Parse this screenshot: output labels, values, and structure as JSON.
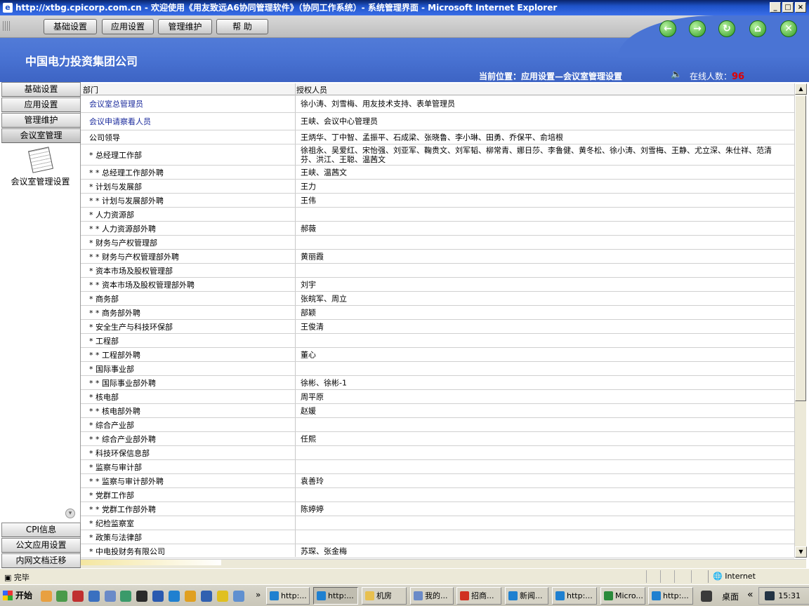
{
  "window": {
    "title": "http://xtbg.cpicorp.com.cn - 欢迎使用《用友致远A6协同管理软件》（协同工作系统）- 系统管理界面 - Microsoft Internet Explorer",
    "min": "_",
    "max": "□",
    "close": "×"
  },
  "topnav": {
    "items": [
      "基础设置",
      "应用设置",
      "管理维护",
      "帮  助"
    ]
  },
  "header": {
    "company": "中国电力投资集团公司",
    "location_label": "当前位置：",
    "location_value": "应用设置—会议室管理设置",
    "online_label": "在线人数：",
    "online_count": "96"
  },
  "sidebar": {
    "tabs": [
      "基础设置",
      "应用设置",
      "管理维护",
      "会议室管理"
    ],
    "item_label": "会议室管理设置",
    "bottom_tabs": [
      "CPI信息",
      "公文应用设置",
      "内网文档迁移"
    ]
  },
  "table": {
    "col_dept": "部门",
    "col_people": "授权人员",
    "rows": [
      {
        "dept": "会议室总管理员",
        "people": "徐小涛、刘雪梅、用友技术支持、表单管理员",
        "link": true
      },
      {
        "dept": "会议申请察看人员",
        "people": "王峡、会议中心管理员",
        "link": true
      },
      {
        "dept": "公司领导",
        "people": "王炳华、丁中智、孟振平、石成梁、张晓鲁、李小琳、田勇、乔保平、俞培根"
      },
      {
        "dept": "* 总经理工作部",
        "people": "徐祖永、吴爱红、宋怡强、刘亚军、鞠贵文、刘军韬、柳常青、娜日莎、李鲁健、黄冬松、徐小涛、刘雪梅、王静、尤立深、朱仕祥、范清芬、洪江、王聪、温茜文",
        "tall": true
      },
      {
        "dept": "* * 总经理工作部外聘",
        "people": "王峡、温茜文"
      },
      {
        "dept": "* 计划与发展部",
        "people": "王力"
      },
      {
        "dept": "* * 计划与发展部外聘",
        "people": "王伟"
      },
      {
        "dept": "* 人力资源部",
        "people": ""
      },
      {
        "dept": "* * 人力资源部外聘",
        "people": "郝薇"
      },
      {
        "dept": "* 财务与产权管理部",
        "people": ""
      },
      {
        "dept": "* * 财务与产权管理部外聘",
        "people": "黄丽霞"
      },
      {
        "dept": "* 资本市场及股权管理部",
        "people": ""
      },
      {
        "dept": "* * 资本市场及股权管理部外聘",
        "people": "刘宇"
      },
      {
        "dept": "* 商务部",
        "people": "张皖军、周立"
      },
      {
        "dept": "* * 商务部外聘",
        "people": "部颖"
      },
      {
        "dept": "* 安全生产与科技环保部",
        "people": "王俊清"
      },
      {
        "dept": "* 工程部",
        "people": ""
      },
      {
        "dept": "* * 工程部外聘",
        "people": "董心"
      },
      {
        "dept": "* 国际事业部",
        "people": ""
      },
      {
        "dept": "* * 国际事业部外聘",
        "people": "徐彬、徐彬-1"
      },
      {
        "dept": "* 核电部",
        "people": "周平原"
      },
      {
        "dept": "* * 核电部外聘",
        "people": "赵媛"
      },
      {
        "dept": "* 综合产业部",
        "people": ""
      },
      {
        "dept": "* * 综合产业部外聘",
        "people": "任熙"
      },
      {
        "dept": "* 科技环保信息部",
        "people": ""
      },
      {
        "dept": "* 监察与审计部",
        "people": ""
      },
      {
        "dept": "* * 监察与审计部外聘",
        "people": "袁善玲"
      },
      {
        "dept": "* 党群工作部",
        "people": ""
      },
      {
        "dept": "* * 党群工作部外聘",
        "people": "陈婷婷"
      },
      {
        "dept": "* 纪检监察室",
        "people": ""
      },
      {
        "dept": "* 政策与法律部",
        "people": ""
      },
      {
        "dept": "* 中电投财务有限公司",
        "people": "苏琛、张金梅"
      }
    ]
  },
  "statusbar": {
    "status": "完毕",
    "zone": "Internet"
  },
  "taskbar": {
    "start": "开始",
    "buttons": [
      "http:...",
      "http:...",
      "机房",
      "我的...",
      "招商...",
      "新闻...",
      "http:...",
      "Micro...",
      "http:..."
    ],
    "desktop": "桌面",
    "chevron": "«",
    "clock": "15:31"
  }
}
